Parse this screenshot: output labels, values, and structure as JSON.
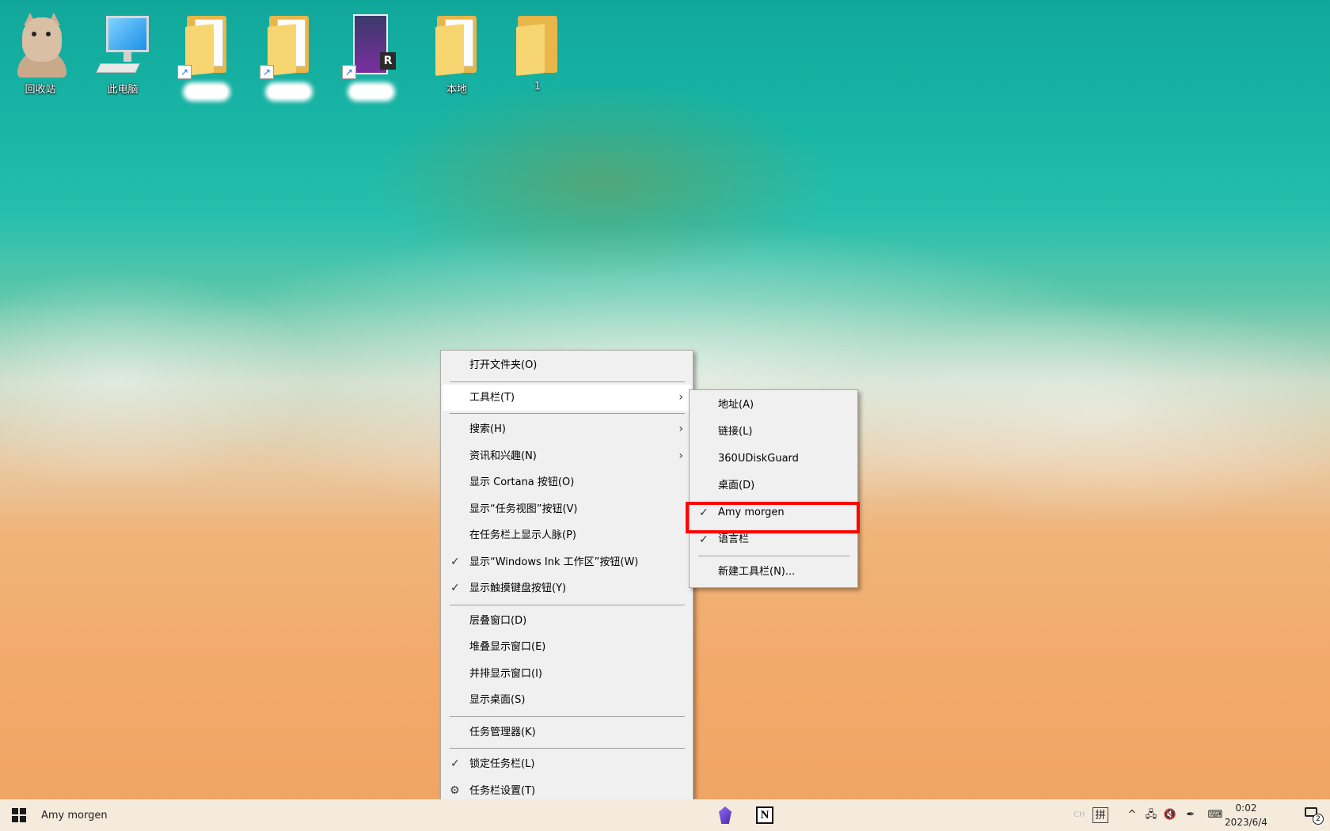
{
  "desktop": {
    "icons": [
      {
        "label": "回收站"
      },
      {
        "label": "此电脑"
      },
      {
        "label": ""
      },
      {
        "label": ""
      },
      {
        "label": ""
      },
      {
        "label": "本地"
      },
      {
        "label": "1"
      }
    ]
  },
  "main_menu": {
    "items": [
      {
        "label": "打开文件夹(O)"
      },
      {
        "label": "工具栏(T)"
      },
      {
        "label": "搜索(H)"
      },
      {
        "label": "资讯和兴趣(N)"
      },
      {
        "label": "显示 Cortana 按钮(O)"
      },
      {
        "label": "显示“任务视图”按钮(V)"
      },
      {
        "label": "在任务栏上显示人脉(P)"
      },
      {
        "label": "显示“Windows Ink 工作区”按钮(W)",
        "checked": true
      },
      {
        "label": "显示触摸键盘按钮(Y)",
        "checked": true
      },
      {
        "label": "层叠窗口(D)"
      },
      {
        "label": "堆叠显示窗口(E)"
      },
      {
        "label": "并排显示窗口(I)"
      },
      {
        "label": "显示桌面(S)"
      },
      {
        "label": "任务管理器(K)"
      },
      {
        "label": "锁定任务栏(L)",
        "checked": true
      },
      {
        "label": "任务栏设置(T)"
      }
    ]
  },
  "toolbar_submenu": {
    "items": [
      {
        "label": "地址(A)"
      },
      {
        "label": "链接(L)"
      },
      {
        "label": "360UDiskGuard"
      },
      {
        "label": "桌面(D)"
      },
      {
        "label": "Amy morgen",
        "checked": true
      },
      {
        "label": "语言栏",
        "checked": true
      },
      {
        "label": "新建工具栏(N)..."
      }
    ]
  },
  "taskbar": {
    "toolbar_label": "Amy morgen",
    "tray": {
      "ime_lang": "CH",
      "ime_mode": "拼"
    },
    "clock_time": "0:02",
    "clock_date": "2023/6/4",
    "notification_count": "2"
  },
  "colors": {
    "highlight_box": "#ff0000",
    "menu_bg": "#f0f0f0",
    "taskbar_bg": "#f4ebdd"
  }
}
